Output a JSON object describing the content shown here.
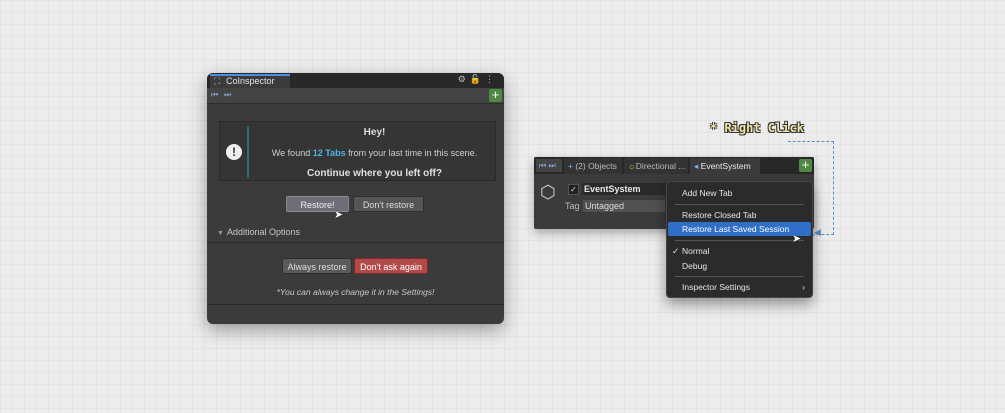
{
  "left_panel": {
    "tab_title": "CoInspector",
    "notice": {
      "heading": "Hey!",
      "message_prefix": "We found",
      "tabs_count": "12 Tabs",
      "message_suffix": "from your last time in this scene.",
      "prompt": "Continue where you left off?"
    },
    "buttons": {
      "restore": "Restore!",
      "dont_restore": "Don't restore",
      "always_restore": "Always restore",
      "dont_ask": "Don't ask again"
    },
    "additional_options": "Additional Options",
    "settings_note": "*You can always change it in the Settings!"
  },
  "right_panel": {
    "tabs": [
      "(2) Objects",
      "Directional ...",
      "EventSystem"
    ],
    "object_name": "EventSystem",
    "tag_label": "Tag",
    "tag_value": "Untagged"
  },
  "context_menu": {
    "items": [
      "Add New Tab",
      "Restore Closed Tab",
      "Restore Last Saved Session",
      "Normal",
      "Debug",
      "Inspector Settings"
    ],
    "selected": "Restore Last Saved Session",
    "checked": "Normal"
  },
  "annotation": {
    "label": "* Right Click"
  },
  "colors": {
    "accent": "#4fb3e8",
    "danger": "#b34a4a",
    "selection": "#2f6fc8",
    "add": "#4f8a45"
  }
}
